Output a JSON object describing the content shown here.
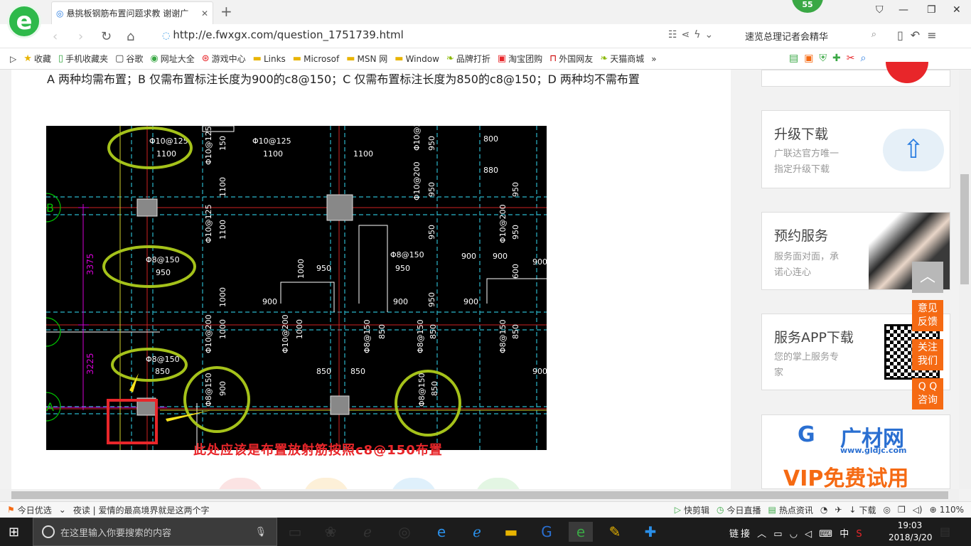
{
  "browser": {
    "tab_title": "悬挑板钢筋布置问题求教 谢谢广",
    "new_tab_symbol": "+",
    "badge": "55",
    "url": "http://e.fwxgx.com/question_1751739.html",
    "search_text": "速览总理记者会精华",
    "bookmarks": [
      "收藏",
      "手机收藏夹",
      "谷歌",
      "网址大全",
      "游戏中心",
      "Links",
      "Microsof",
      "MSN 网",
      "Window",
      "品牌打折",
      "淘宝团购",
      "外国网友",
      "天猫商城"
    ],
    "bookmarks_more": "»"
  },
  "page": {
    "question_text": "A  两种均需布置；B  仅需布置标注长度为900的c8@150；C  仅需布置标注长度为850的c8@150；D  两种均不需布置",
    "image_caption": "此处应该是布置放射筋按照c8@150布置",
    "cad_labels": {
      "rebar_1": "Φ10@125",
      "rebar_2": "Φ8@150",
      "len_1100": "1100",
      "len_950": "950",
      "len_850": "850",
      "len_900": "900",
      "len_800": "800",
      "len_880": "880",
      "dim_3375": "3375",
      "dim_3225": "3225",
      "axis_b": "B",
      "axis_a": "A",
      "rebar_3": "Φ10@200",
      "rebar_4": "Φ10@125",
      "len_1000": "1000",
      "len_150": "150",
      "len_600": "600"
    }
  },
  "sidebar": {
    "upgrade_title": "升级下载",
    "upgrade_desc_1": "广联达官方唯一",
    "upgrade_desc_2": "指定升级下载",
    "booking_title": "预约服务",
    "booking_desc_1": "服务面对面，承",
    "booking_desc_2": "诺心连心",
    "app_title": "服务APP下载",
    "app_desc_1": "您的掌上服务专",
    "app_desc_2": "家",
    "ad_brand": "广材网",
    "ad_url": "www.gldjc.com",
    "ad_slogan": "VIP免费试用"
  },
  "float_buttons": {
    "feedback_1": "意见",
    "feedback_2": "反馈",
    "follow_1": "关注",
    "follow_2": "我们",
    "qq_1": "Q Q",
    "qq_2": "咨询"
  },
  "statusbar": {
    "today_pick": "今日优选",
    "news": "夜读 | 爱情的最高境界就是这两个字",
    "quick_cut": "快剪辑",
    "live": "今日直播",
    "hot": "热点资讯",
    "download": "下载",
    "zoom": "110%"
  },
  "taskbar": {
    "search_placeholder": "在这里输入你要搜索的内容",
    "tray_link": "链接",
    "ime": "中",
    "time": "19:03",
    "date": "2018/3/20"
  },
  "colors": {
    "accent_green": "#2eb94a",
    "orange": "#f56a13",
    "caption_red": "#e8262a",
    "cad_green": "#a5c21a"
  }
}
